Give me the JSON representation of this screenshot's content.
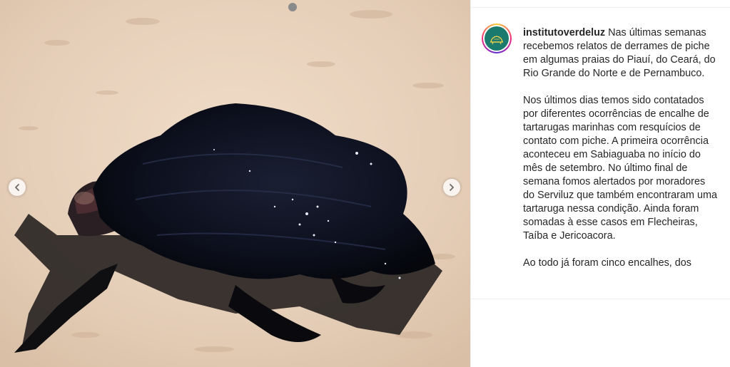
{
  "post": {
    "account": {
      "username": "institutoverdeluz"
    },
    "caption": {
      "first_paragraph": "Nas últimas semanas recebemos relatos de derrames de piche em algumas praias do Piauí, do Ceará, do Rio Grande do Norte e de Pernambuco.",
      "second_paragraph": "Nos últimos dias temos sido contatados por diferentes ocorrências de encalhe de tartarugas marinhas com resquícios de contato com piche. A primeira ocorrência aconteceu em Sabiaguaba no início do mês de setembro. No último final de semana fomos alertados por moradores do Serviluz que também encontraram uma tartaruga nessa condição. Ainda foram somadas à esse casos em Flecheiras, Taíba e Jericoacora.",
      "third_paragraph": "Ao todo já foram cinco encalhes, dos"
    },
    "media": {
      "prev_icon": "chevron-left-icon",
      "next_icon": "chevron-right-icon"
    },
    "colors": {
      "sand": "#e8d3bf",
      "avatar_bg": "#1a7a6d",
      "text": "#262626"
    }
  }
}
